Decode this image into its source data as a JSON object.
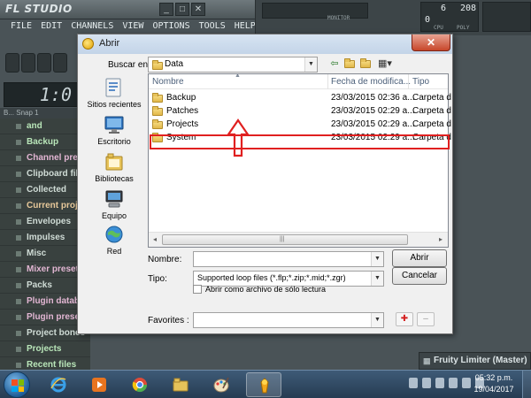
{
  "fl": {
    "logo": "FL STUDIO",
    "window_buttons": [
      "_",
      "□",
      "✕"
    ],
    "menus": [
      "FILE",
      "EDIT",
      "CHANNELS",
      "VIEW",
      "OPTIONS",
      "TOOLS",
      "HELP"
    ],
    "monitor_label": "MONITOR",
    "cpu_value": "6",
    "poly_value": "208",
    "mem_value": "0",
    "cpu_label": "CPU",
    "poly_label": "POLY",
    "time": "1:0",
    "browser_header": "B... Snap 1",
    "browser_items": [
      {
        "label": "and",
        "tone": "green"
      },
      {
        "label": "Backup",
        "tone": "green"
      },
      {
        "label": "Channel presets",
        "tone": "pink"
      },
      {
        "label": "Clipboard files",
        "tone": "normal"
      },
      {
        "label": "Collected",
        "tone": "normal"
      },
      {
        "label": "Current project",
        "tone": "orange"
      },
      {
        "label": "Envelopes",
        "tone": "normal"
      },
      {
        "label": "Impulses",
        "tone": "normal"
      },
      {
        "label": "Misc",
        "tone": "normal"
      },
      {
        "label": "Mixer presets",
        "tone": "pink"
      },
      {
        "label": "Packs",
        "tone": "normal"
      },
      {
        "label": "Plugin database",
        "tone": "pink"
      },
      {
        "label": "Plugin presets",
        "tone": "pink"
      },
      {
        "label": "Project bones",
        "tone": "normal"
      },
      {
        "label": "Projects",
        "tone": "green"
      },
      {
        "label": "Recent files",
        "tone": "green"
      }
    ],
    "limiter": "Fruity Limiter (Master)"
  },
  "dialog": {
    "title": "Abrir",
    "close": "✕",
    "look_in_label": "Buscar en:",
    "look_in_value": "Data",
    "nav": {
      "back": "⇦",
      "up": "⇧",
      "new_folder": "✦",
      "views": "▦▾"
    },
    "places": [
      "Sitios recientes",
      "Escritorio",
      "Bibliotecas",
      "Equipo",
      "Red"
    ],
    "columns": {
      "name": "Nombre",
      "date": "Fecha de modifica...",
      "type": "Tipo"
    },
    "files": [
      {
        "name": "Backup",
        "date": "23/03/2015 02:36 a...",
        "type": "Carpeta d"
      },
      {
        "name": "Patches",
        "date": "23/03/2015 02:29 a...",
        "type": "Carpeta d"
      },
      {
        "name": "Projects",
        "date": "23/03/2015 02:29 a...",
        "type": "Carpeta d"
      },
      {
        "name": "System",
        "date": "23/03/2015 02:29 a...",
        "type": "Carpeta d"
      }
    ],
    "scroll_left": "◂",
    "scroll_right": "▸",
    "scroll_grip": "|||",
    "filename_label": "Nombre:",
    "filename_value": "",
    "filetype_label": "Tipo:",
    "filetype_value": "Supported loop files (*.flp;*.zip;*.mid;*.zgr)",
    "open_button": "Abrir",
    "cancel_button": "Cancelar",
    "readonly_label": "Abrir como archivo de sólo lectura",
    "favorites_label": "Favorites :",
    "favorites_value": "",
    "fav_add": "✚",
    "fav_remove": "–"
  },
  "taskbar": {
    "time": "05:32 p.m.",
    "date": "19/04/2017"
  },
  "colors": {
    "highlight": "#e02020",
    "arrow": "#e02020",
    "taskbar": "#2d4761"
  }
}
